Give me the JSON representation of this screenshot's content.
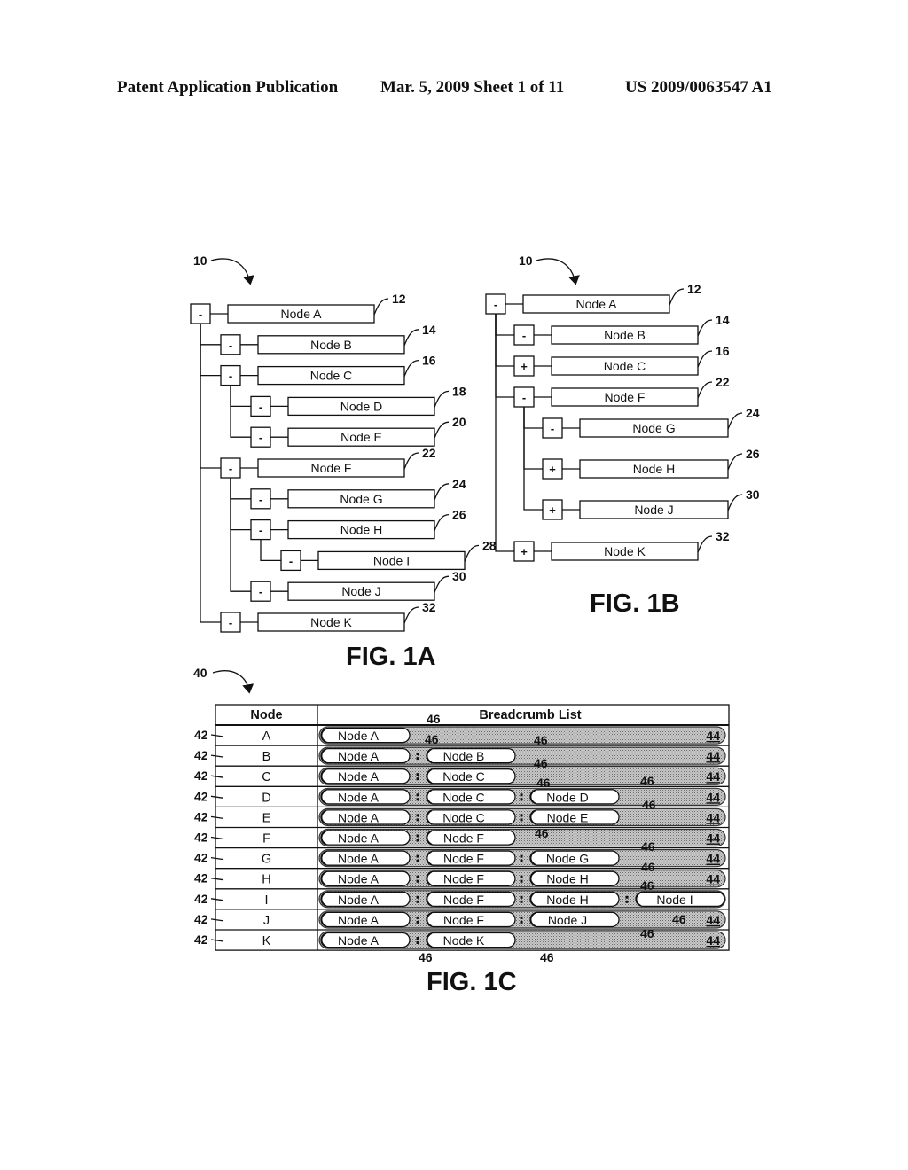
{
  "header": {
    "left": "Patent Application Publication",
    "middle": "Mar. 5, 2009   Sheet 1 of 11",
    "right": "US 2009/0063547 A1"
  },
  "fig1a": {
    "caption": "FIG. 1A",
    "ref": "10",
    "nodes": [
      {
        "label": "Node A",
        "ref": "12",
        "depth": 0,
        "toggle": "-"
      },
      {
        "label": "Node B",
        "ref": "14",
        "depth": 1,
        "toggle": "-"
      },
      {
        "label": "Node C",
        "ref": "16",
        "depth": 1,
        "toggle": "-"
      },
      {
        "label": "Node D",
        "ref": "18",
        "depth": 2,
        "toggle": "-"
      },
      {
        "label": "Node E",
        "ref": "20",
        "depth": 2,
        "toggle": "-"
      },
      {
        "label": "Node F",
        "ref": "22",
        "depth": 1,
        "toggle": "-"
      },
      {
        "label": "Node G",
        "ref": "24",
        "depth": 2,
        "toggle": "-"
      },
      {
        "label": "Node H",
        "ref": "26",
        "depth": 2,
        "toggle": "-"
      },
      {
        "label": "Node I",
        "ref": "28",
        "depth": 3,
        "toggle": "-"
      },
      {
        "label": "Node J",
        "ref": "30",
        "depth": 2,
        "toggle": "-"
      },
      {
        "label": "Node K",
        "ref": "32",
        "depth": 1,
        "toggle": "-"
      }
    ]
  },
  "fig1b": {
    "caption": "FIG. 1B",
    "ref": "10",
    "nodes": [
      {
        "label": "Node A",
        "ref": "12",
        "depth": 0,
        "toggle": "-"
      },
      {
        "label": "Node B",
        "ref": "14",
        "depth": 1,
        "toggle": "-"
      },
      {
        "label": "Node C",
        "ref": "16",
        "depth": 1,
        "toggle": "+"
      },
      {
        "label": "Node F",
        "ref": "22",
        "depth": 1,
        "toggle": "-"
      },
      {
        "label": "Node G",
        "ref": "24",
        "depth": 2,
        "toggle": "-"
      },
      {
        "label": "Node H",
        "ref": "26",
        "depth": 2,
        "toggle": "+"
      },
      {
        "label": "Node J",
        "ref": "30",
        "depth": 2,
        "toggle": "+"
      },
      {
        "label": "Node K",
        "ref": "32",
        "depth": 1,
        "toggle": "+"
      }
    ]
  },
  "fig1c": {
    "caption": "FIG. 1C",
    "ref": "40",
    "row_ref": "42",
    "pill_ref": "46",
    "bar_ref": "44",
    "columns": [
      "Node",
      "Breadcrumb List"
    ],
    "rows": [
      {
        "node": "A",
        "crumbs": [
          "Node A"
        ]
      },
      {
        "node": "B",
        "crumbs": [
          "Node A",
          "Node B"
        ]
      },
      {
        "node": "C",
        "crumbs": [
          "Node A",
          "Node C"
        ]
      },
      {
        "node": "D",
        "crumbs": [
          "Node A",
          "Node C",
          "Node D"
        ]
      },
      {
        "node": "E",
        "crumbs": [
          "Node A",
          "Node C",
          "Node E"
        ]
      },
      {
        "node": "F",
        "crumbs": [
          "Node A",
          "Node F"
        ]
      },
      {
        "node": "G",
        "crumbs": [
          "Node A",
          "Node F",
          "Node G"
        ]
      },
      {
        "node": "H",
        "crumbs": [
          "Node A",
          "Node F",
          "Node H"
        ]
      },
      {
        "node": "I",
        "crumbs": [
          "Node A",
          "Node F",
          "Node H",
          "Node I"
        ]
      },
      {
        "node": "J",
        "crumbs": [
          "Node A",
          "Node F",
          "Node J"
        ]
      },
      {
        "node": "K",
        "crumbs": [
          "Node A",
          "Node K"
        ]
      }
    ],
    "colors": {
      "bar_fill": "#b8b8b8",
      "pill_fill": "#ffffff",
      "line": "#111111"
    }
  }
}
